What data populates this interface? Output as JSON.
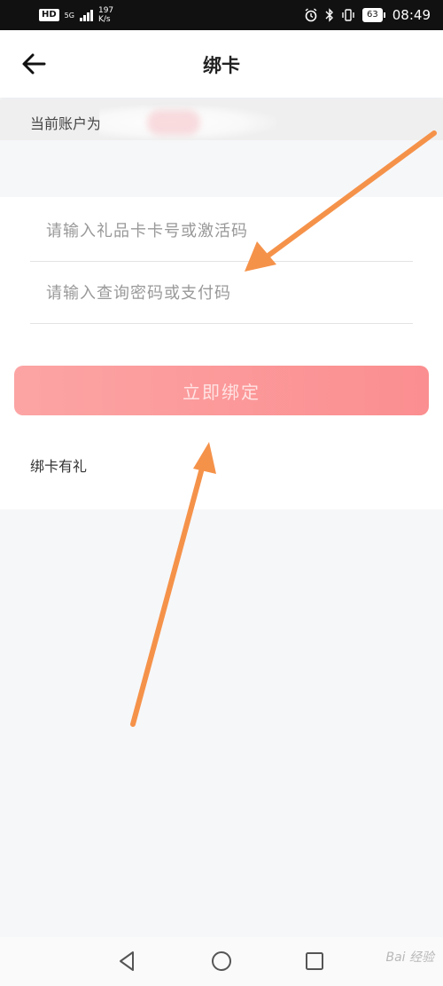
{
  "status_bar": {
    "hd": "HD",
    "network_type": "5G",
    "network_speed_value": "197",
    "network_speed_unit": "K/s",
    "battery": "63",
    "time": "08:49",
    "icons": [
      "alarm-icon",
      "bluetooth-icon",
      "vibrate-icon"
    ]
  },
  "nav": {
    "title": "绑卡",
    "back_icon": "arrow-left-icon"
  },
  "account": {
    "label": "当前账户为"
  },
  "form": {
    "card_number_placeholder": "请输入礼品卡卡号或激活码",
    "password_placeholder": "请输入查询密码或支付码"
  },
  "bind_button": {
    "label": "立即绑定"
  },
  "gift_section": {
    "label": "绑卡有礼"
  },
  "colors": {
    "button_start": "#fca4a4",
    "button_end": "#fb8e90",
    "annotation_arrow": "#f5924a"
  },
  "watermark": {
    "text": "Bai 经验"
  }
}
